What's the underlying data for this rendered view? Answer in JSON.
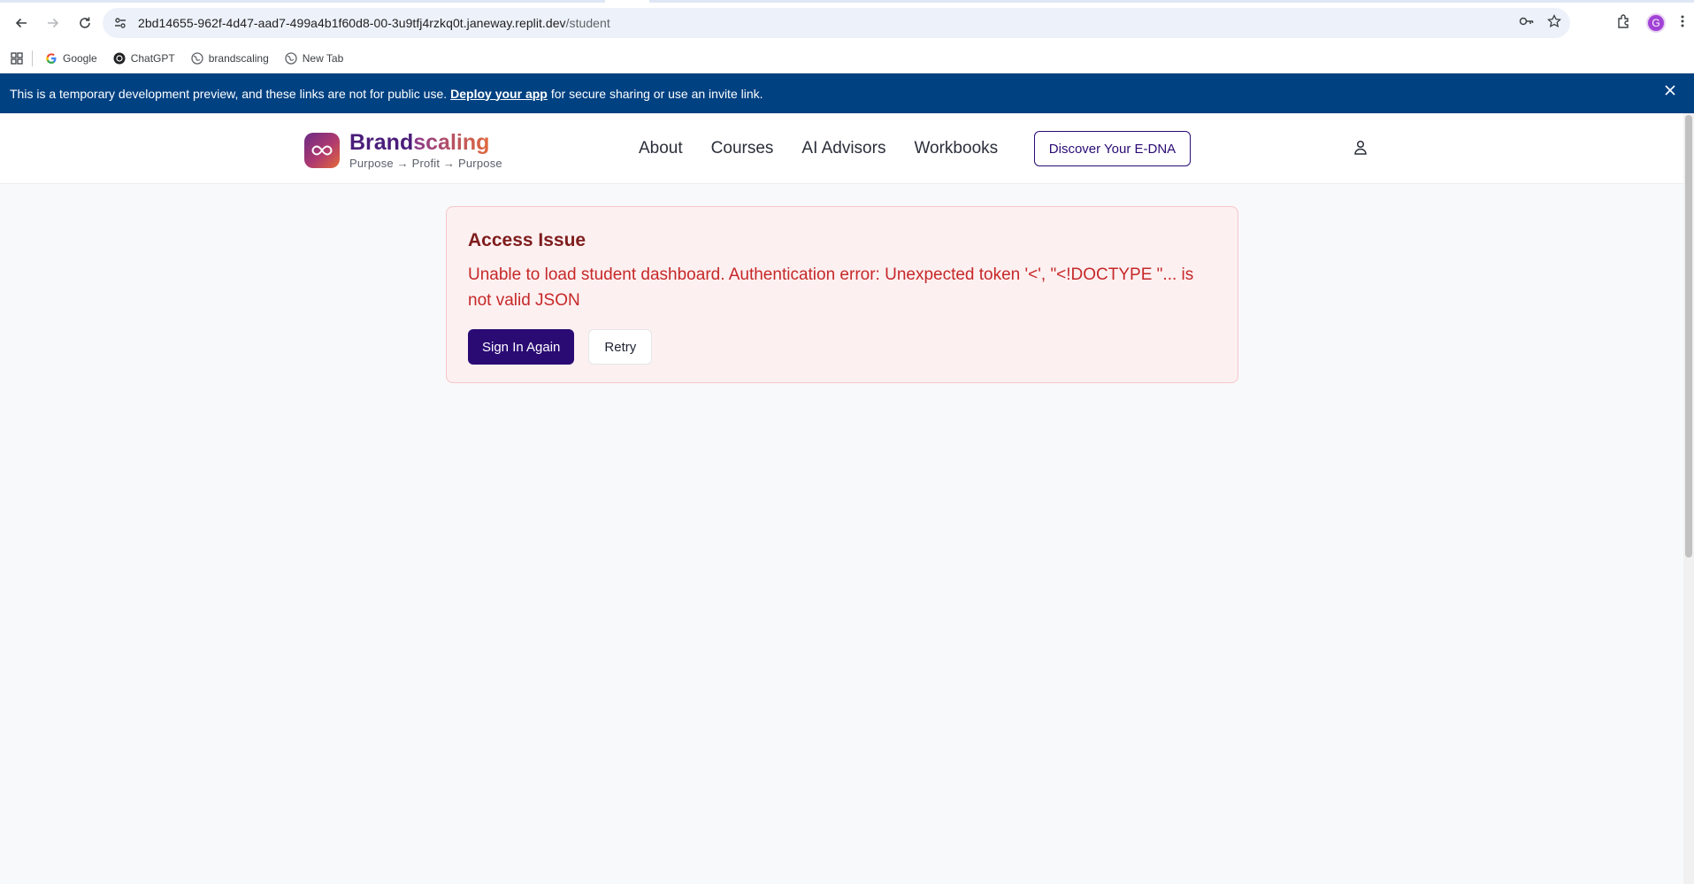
{
  "browser": {
    "url_host": "2bd14655-962f-4d47-aad7-499a4b1f60d8-00-3u9tfj4rzkq0t.janeway.replit.dev",
    "url_path": "/student",
    "profile_initial": "G",
    "bookmarks": [
      {
        "label": "Google",
        "icon": "google-icon"
      },
      {
        "label": "ChatGPT",
        "icon": "chatgpt-icon"
      },
      {
        "label": "brandscaling",
        "icon": "globe-icon"
      },
      {
        "label": "New Tab",
        "icon": "globe-icon"
      }
    ]
  },
  "banner": {
    "text_before": "This is a temporary development preview, and these links are not for public use.",
    "link": "Deploy your app",
    "text_after": "for secure sharing or use an invite link."
  },
  "header": {
    "brand_part1": "Brand",
    "brand_part2": "scaling",
    "tagline": "Purpose → Profit → Purpose",
    "nav": [
      "About",
      "Courses",
      "AI Advisors",
      "Workbooks"
    ],
    "cta": "Discover Your E-DNA"
  },
  "error": {
    "title": "Access Issue",
    "message": "Unable to load student dashboard. Authentication error: Unexpected token '<', \"<!DOCTYPE \"... is not valid JSON",
    "primary_button": "Sign In Again",
    "secondary_button": "Retry"
  },
  "colors": {
    "banner_bg": "#004182",
    "brand_purple": "#2a0b74",
    "error_bg": "#fdf0f1",
    "error_border": "#f6c6c9",
    "error_text": "#c62828"
  }
}
